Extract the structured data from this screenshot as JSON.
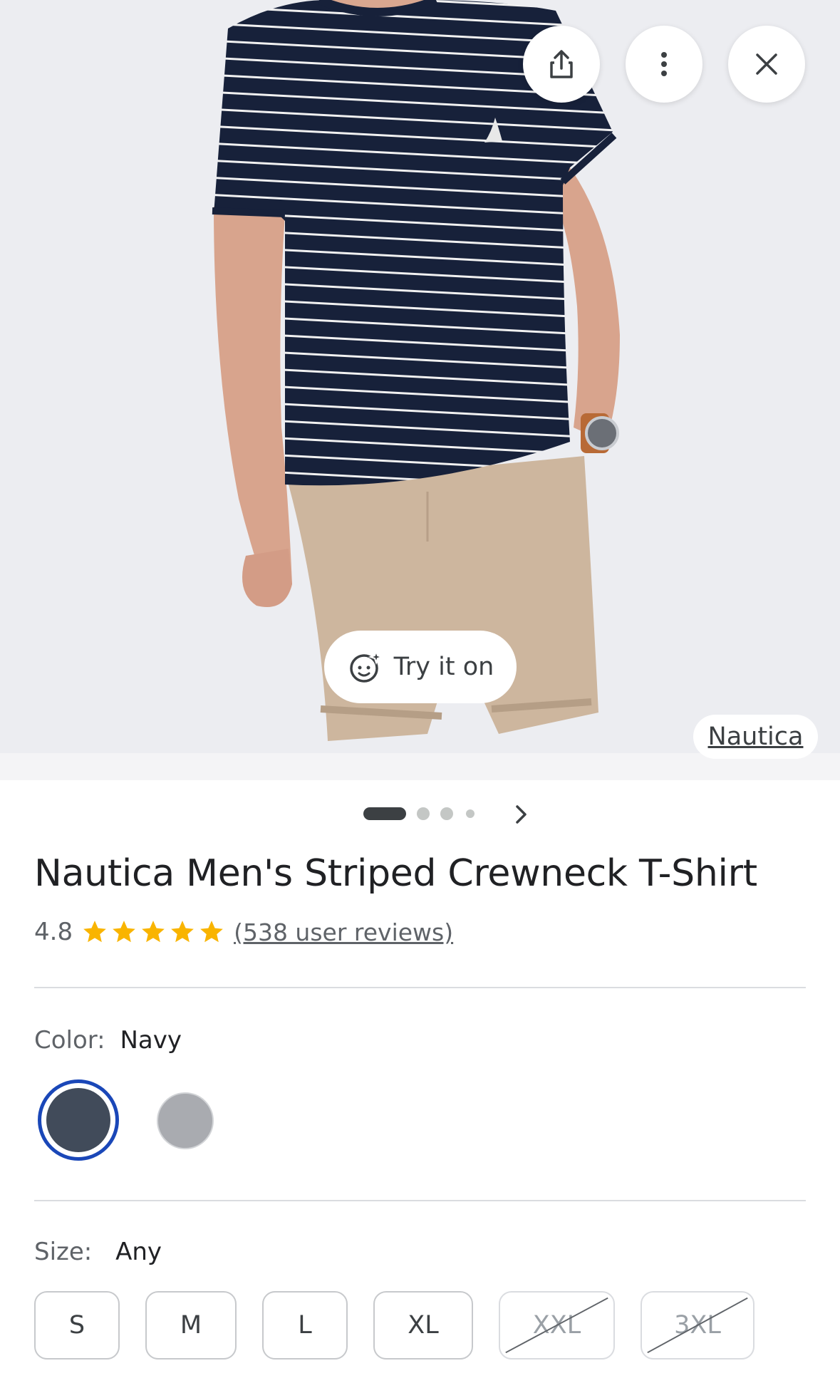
{
  "header": {
    "share_icon": "share-icon",
    "more_icon": "more-vert-icon",
    "close_icon": "close-icon"
  },
  "hero": {
    "try_on_label": "Try it on",
    "try_on_icon": "face-sparkle-icon",
    "brand_link": "Nautica",
    "background": "#ecedf1"
  },
  "pager": {
    "total_dots": 4,
    "active_index": 0,
    "next_icon": "chevron-right-icon"
  },
  "product": {
    "title": "Nautica Men's Striped Crewneck T-Shirt",
    "rating": "4.8",
    "stars": 5,
    "reviews_label": "(538 user reviews)"
  },
  "color": {
    "label": "Color:",
    "value": "Navy",
    "options": [
      {
        "name": "Navy",
        "hex": "#414b5a",
        "selected": true
      },
      {
        "name": "Gray",
        "hex": "#a9abb0",
        "selected": false
      }
    ],
    "selected_ring": "#1a47b8"
  },
  "size": {
    "label": "Size:",
    "value": "Any",
    "options": [
      {
        "label": "S",
        "available": true
      },
      {
        "label": "M",
        "available": true
      },
      {
        "label": "L",
        "available": true
      },
      {
        "label": "XL",
        "available": true
      },
      {
        "label": "XXL",
        "available": false
      },
      {
        "label": "3XL",
        "available": false
      }
    ]
  },
  "colors": {
    "star": "#f9b400",
    "text_primary": "#202124",
    "text_secondary": "#5f6368"
  }
}
